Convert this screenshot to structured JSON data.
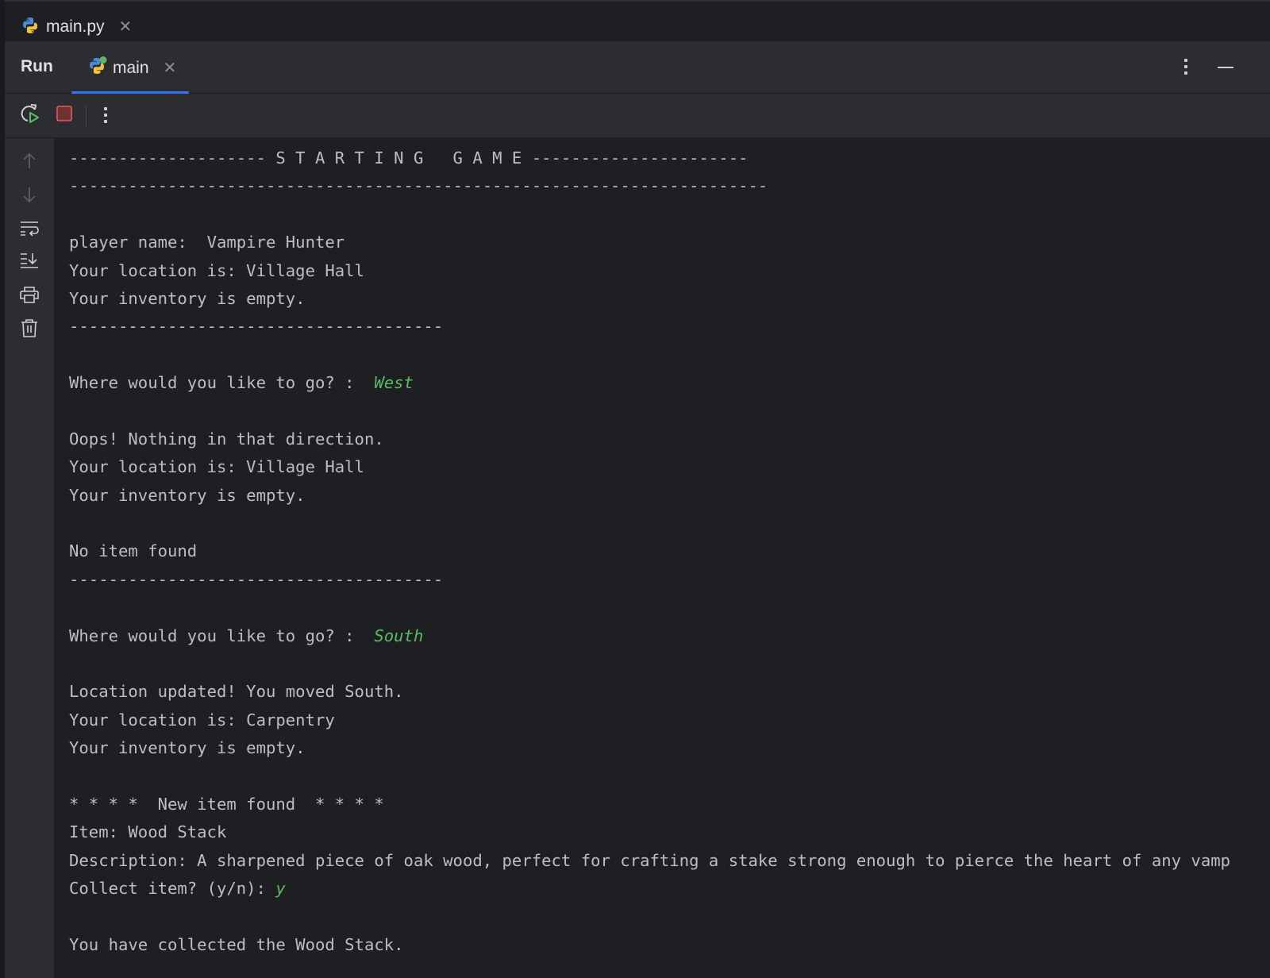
{
  "editor": {
    "tabs": [
      {
        "label": "main.py",
        "icon": "python-file-icon",
        "close_icon": "close-icon"
      }
    ]
  },
  "run_window": {
    "title": "Run",
    "tabs": [
      {
        "label": "main",
        "icon": "python-run-config-icon",
        "status": "running",
        "active": true,
        "close_icon": "close-icon"
      }
    ],
    "header_actions": [
      {
        "icon": "more-options-icon"
      },
      {
        "icon": "minimize-icon"
      }
    ],
    "accent_color": "#3574f0"
  },
  "toolbar": {
    "buttons": [
      {
        "icon": "rerun-icon"
      },
      {
        "icon": "stop-icon"
      },
      {
        "icon": "more-options-icon"
      }
    ]
  },
  "gutter": {
    "buttons": [
      {
        "icon": "scroll-up-icon",
        "enabled": false
      },
      {
        "icon": "scroll-down-icon",
        "enabled": false
      },
      {
        "icon": "soft-wrap-icon",
        "enabled": true
      },
      {
        "icon": "scroll-to-end-icon",
        "enabled": true
      },
      {
        "icon": "print-icon",
        "enabled": true
      },
      {
        "icon": "clear-all-icon",
        "enabled": true
      }
    ]
  },
  "console": {
    "text_color": "#bcbec4",
    "input_color": "#5fb865",
    "lines": [
      {
        "text": "-------------------- S T A R T I N G   G A M E ----------------------",
        "input": ""
      },
      {
        "text": "-----------------------------------------------------------------------",
        "input": ""
      },
      {
        "text": "",
        "input": ""
      },
      {
        "text": "player name:  Vampire Hunter",
        "input": ""
      },
      {
        "text": "Your location is: Village Hall",
        "input": ""
      },
      {
        "text": "Your inventory is empty.",
        "input": ""
      },
      {
        "text": "--------------------------------------",
        "input": ""
      },
      {
        "text": "",
        "input": ""
      },
      {
        "text": "Where would you like to go? :  ",
        "input": "West"
      },
      {
        "text": "",
        "input": ""
      },
      {
        "text": "Oops! Nothing in that direction.",
        "input": ""
      },
      {
        "text": "Your location is: Village Hall",
        "input": ""
      },
      {
        "text": "Your inventory is empty.",
        "input": ""
      },
      {
        "text": "",
        "input": ""
      },
      {
        "text": "No item found",
        "input": ""
      },
      {
        "text": "--------------------------------------",
        "input": ""
      },
      {
        "text": "",
        "input": ""
      },
      {
        "text": "Where would you like to go? :  ",
        "input": "South"
      },
      {
        "text": "",
        "input": ""
      },
      {
        "text": "Location updated! You moved South.",
        "input": ""
      },
      {
        "text": "Your location is: Carpentry",
        "input": ""
      },
      {
        "text": "Your inventory is empty.",
        "input": ""
      },
      {
        "text": "",
        "input": ""
      },
      {
        "text": "* * * *  New item found  * * * *",
        "input": ""
      },
      {
        "text": "Item: Wood Stack",
        "input": ""
      },
      {
        "text": "Description: A sharpened piece of oak wood, perfect for crafting a stake strong enough to pierce the heart of any vamp",
        "input": ""
      },
      {
        "text": "Collect item? (y/n): ",
        "input": "y"
      },
      {
        "text": "",
        "input": ""
      },
      {
        "text": "You have collected the Wood Stack.",
        "input": ""
      }
    ]
  }
}
